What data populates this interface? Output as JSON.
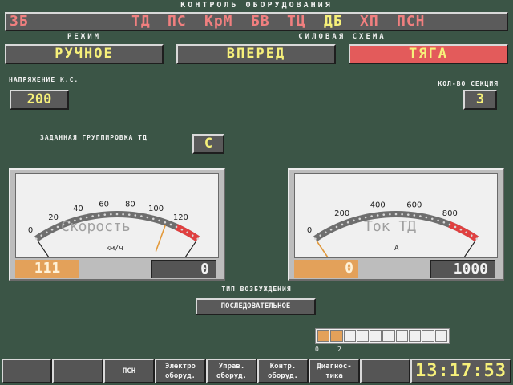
{
  "header": {
    "title": "КОНТРОЛЬ ОБОРУДОВАНИЯ"
  },
  "status_bar": {
    "loco": "3Б",
    "items": [
      "ТД",
      "ПС",
      "КрМ",
      "БВ",
      "ТЦ",
      "ДБ",
      "ХП",
      "ПСН"
    ],
    "colors": {
      "active": "#f07f7f",
      "alt": "#f6f07a"
    }
  },
  "mode": {
    "label": "РЕЖИМ",
    "value": "РУЧНОЕ"
  },
  "power_scheme": {
    "label": "СИЛОВАЯ СХЕМА",
    "direction": "ВПЕРЕД",
    "state": "ТЯГА",
    "state_color": "#e35b5b"
  },
  "voltage": {
    "label": "НАПРЯЖЕНИЕ К.С.",
    "value": "200"
  },
  "sections": {
    "label": "КОЛ-ВО СЕКЦИЯ",
    "value": "3"
  },
  "grouping": {
    "label": "ЗАДАННАЯ ГРУППИРОВКА ТД",
    "value": "С"
  },
  "speed_gauge": {
    "title": "Скорость",
    "unit": "км/ч",
    "ticks": [
      "0",
      "20",
      "40",
      "60",
      "80",
      "100",
      "120"
    ],
    "max": 140,
    "redline_from": 120,
    "needle_value": 111,
    "current": "111",
    "setpoint": "0"
  },
  "current_gauge": {
    "title": "Ток ТД",
    "unit": "А",
    "ticks": [
      "0",
      "200",
      "400",
      "600",
      "800"
    ],
    "max": 1000,
    "redline_from": 820,
    "needle_value": 0,
    "current": "0",
    "setpoint": "1000"
  },
  "excitation": {
    "label": "ТИП ВОЗБУЖДЕНИЯ",
    "value": "ПОСЛЕДОВАТЕЛЬНОЕ"
  },
  "scale_bar": {
    "segments": 10,
    "filled": 2,
    "label_start": "0",
    "label_mark": "2"
  },
  "bottom": {
    "buttons": [
      "",
      "",
      "ПСН",
      "Электро\nоборуд.",
      "Управ.\nоборуд.",
      "Контр.\nоборуд.",
      "Диагнос-\nтика",
      ""
    ],
    "clock": "13:17:53"
  }
}
